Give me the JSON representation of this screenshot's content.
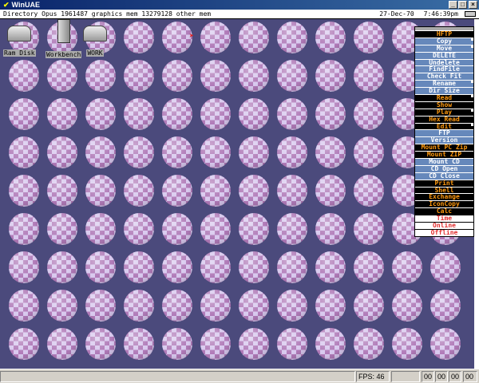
{
  "window": {
    "title": "WinUAE",
    "minimize": "_",
    "maximize": "□",
    "close": "×"
  },
  "screen_bar": {
    "left_text": "Directory Opus  1961487 graphics mem  13279128 other mem",
    "date": "27-Dec-70",
    "time": "7:46:39pm"
  },
  "desktop_icons": [
    {
      "label": "Ram Disk"
    },
    {
      "label": "Workbench"
    },
    {
      "label": "WORK"
    }
  ],
  "menu": {
    "items": [
      {
        "label": "HFTP",
        "style": "black",
        "sub": false
      },
      {
        "label": "Copy",
        "style": "blue",
        "sub": true
      },
      {
        "label": "Move",
        "style": "blue",
        "sub": true
      },
      {
        "label": "DELETE",
        "style": "blue",
        "sub": false
      },
      {
        "label": "Undelete",
        "style": "blue",
        "sub": false
      },
      {
        "label": "FindFile",
        "style": "blue",
        "sub": false
      },
      {
        "label": "Check Fit",
        "style": "blue",
        "sub": false
      },
      {
        "label": "Rename",
        "style": "blue",
        "sub": true
      },
      {
        "label": "Dir Size",
        "style": "blue",
        "sub": false
      },
      {
        "label": "Read",
        "style": "black",
        "sub": true
      },
      {
        "label": "Show",
        "style": "black",
        "sub": false
      },
      {
        "label": "Play",
        "style": "black",
        "sub": true
      },
      {
        "label": "Hex Read",
        "style": "black",
        "sub": false
      },
      {
        "label": "Edit",
        "style": "black",
        "sub": true
      },
      {
        "label": "FTP",
        "style": "blue",
        "sub": false
      },
      {
        "label": "Version",
        "style": "blue",
        "sub": false
      },
      {
        "label": "Mount PC Zip",
        "style": "black",
        "sub": false
      },
      {
        "label": "Mount ZIP",
        "style": "black",
        "sub": false
      },
      {
        "label": "Mount CD",
        "style": "blue",
        "sub": false
      },
      {
        "label": "CD Open",
        "style": "blue",
        "sub": false
      },
      {
        "label": "CD Close",
        "style": "blue",
        "sub": false
      },
      {
        "label": "Print",
        "style": "black",
        "sub": false
      },
      {
        "label": "Shell",
        "style": "black",
        "sub": false
      },
      {
        "label": "Exchange",
        "style": "black",
        "sub": false
      },
      {
        "label": "IconCopy",
        "style": "black",
        "sub": false
      },
      {
        "label": "Calc",
        "style": "black",
        "sub": false
      },
      {
        "label": "Time",
        "style": "white",
        "sub": false
      },
      {
        "label": "Online",
        "style": "white",
        "sub": false
      },
      {
        "label": "Offline",
        "style": "white",
        "sub": false
      }
    ]
  },
  "status": {
    "fps": "FPS: 46",
    "drives": [
      "00",
      "00",
      "00",
      "00"
    ]
  },
  "colors": {
    "desktop": "#4b4a7c",
    "menu_blue": "#6688bb",
    "menu_orange": "#ff9a10",
    "menu_red": "#e23030"
  }
}
